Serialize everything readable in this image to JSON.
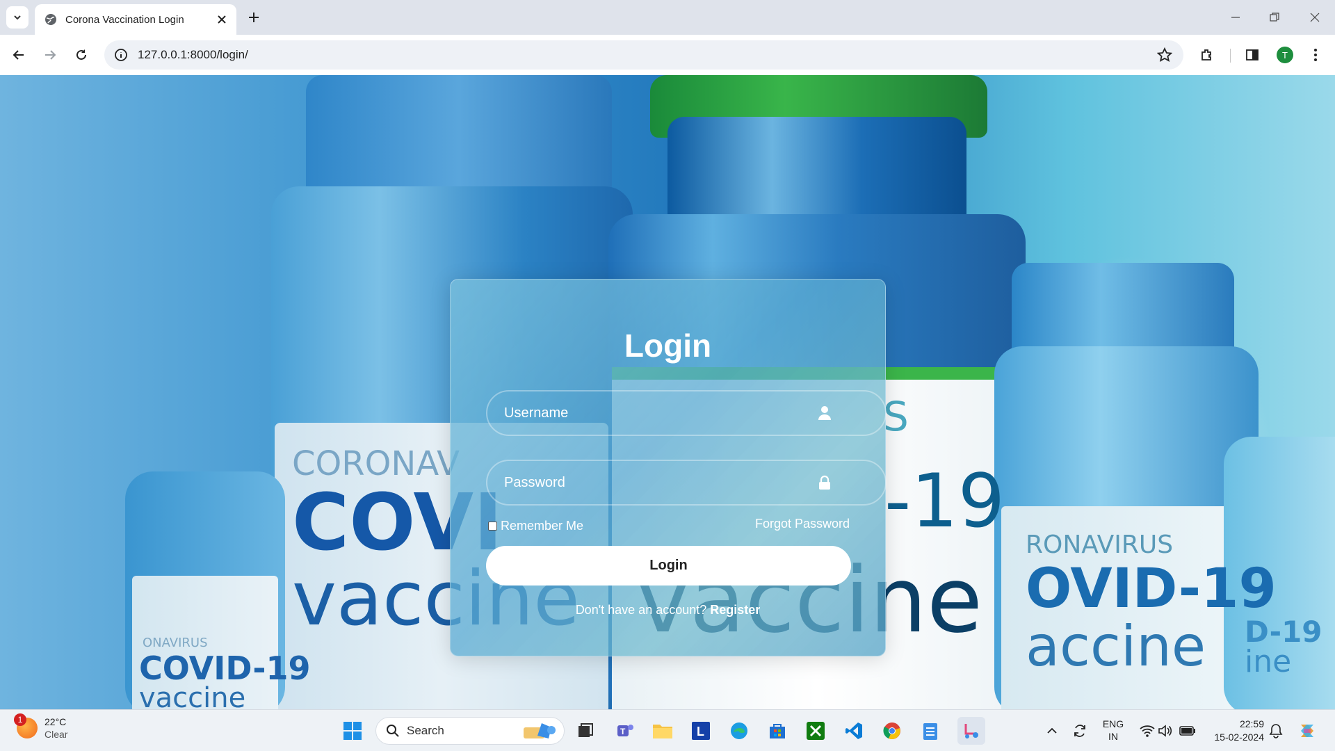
{
  "browser": {
    "tab_title": "Corona Vaccination Login",
    "url": "127.0.0.1:8000/login/",
    "profile_initial": "T"
  },
  "background": {
    "left_small_vial_text": [
      "ONAVIRUS",
      "COVID-19",
      "vaccine"
    ],
    "left_vial_text": [
      "CORONAV",
      "COVI",
      "vaccine"
    ],
    "center_vial_text": [
      "S",
      "-19",
      "vaccine"
    ],
    "right_vial_text": [
      "RONAVIRUS",
      "OVID-19",
      "accine"
    ],
    "far_right_vial_text": [
      "D-19",
      "ine"
    ]
  },
  "login": {
    "title": "Login",
    "username_placeholder": "Username",
    "password_placeholder": "Password",
    "remember_label": "Remember Me",
    "forgot_label": "Forgot Password",
    "button_label": "Login",
    "register_prompt": "Don't have an account?",
    "register_link": "Register"
  },
  "taskbar": {
    "weather_badge": "1",
    "temperature": "22°C",
    "condition": "Clear",
    "search_label": "Search",
    "language": "ENG",
    "region": "IN",
    "time": "22:59",
    "date": "15-02-2024"
  },
  "colors": {
    "accent_green": "#1e8e3e",
    "card_tint": "#5aaad2",
    "page_blue": "#1e74b9"
  }
}
